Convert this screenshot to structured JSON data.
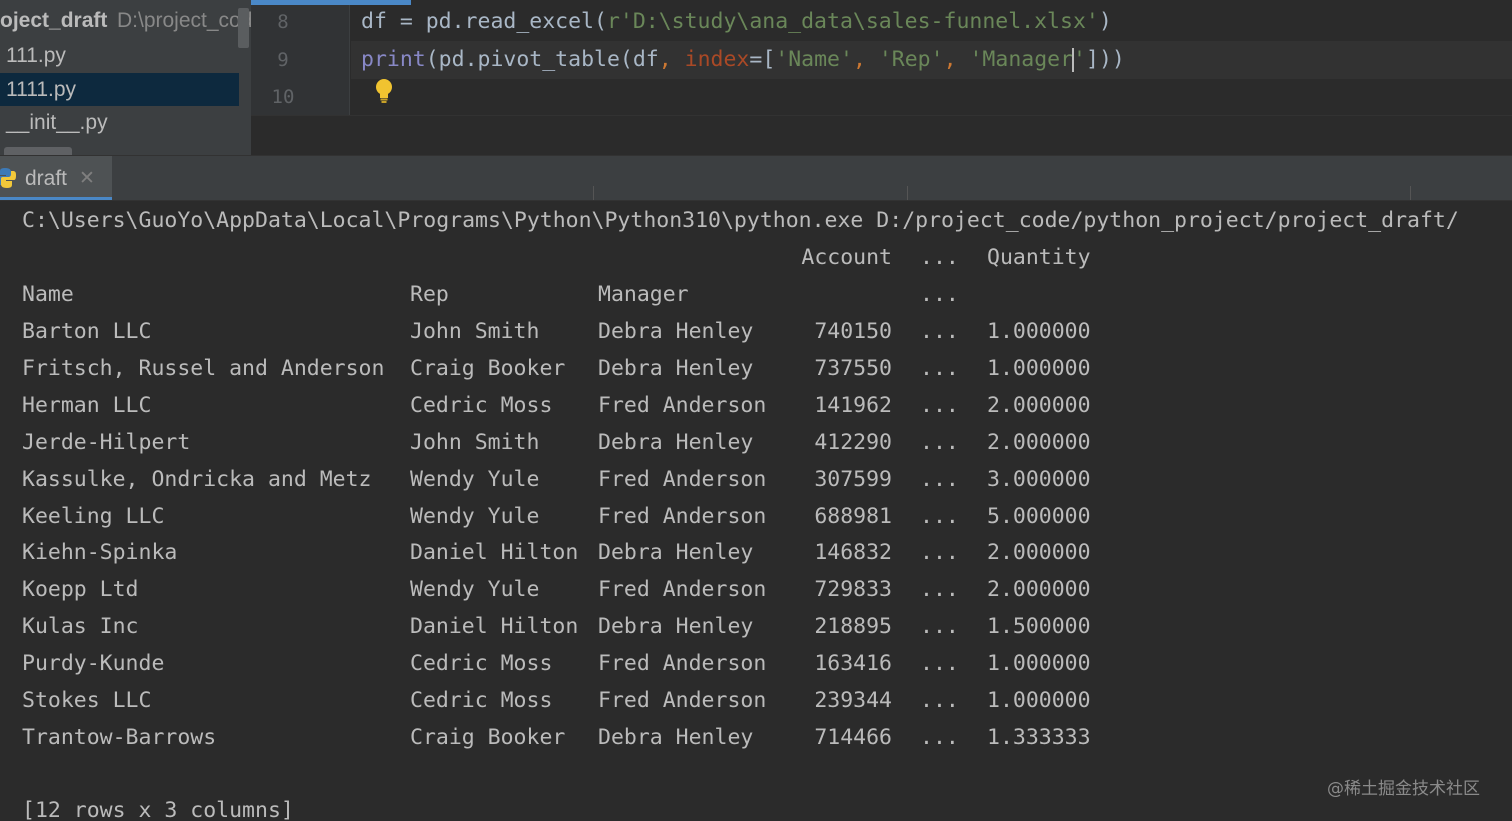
{
  "project_tree": {
    "root_name": "oject_draft",
    "root_path": "D:\\project_cod",
    "items": [
      {
        "label": "111.py",
        "selected": false
      },
      {
        "label": "1111.py",
        "selected": true
      },
      {
        "label": "__init__.py",
        "selected": false
      }
    ]
  },
  "editor": {
    "lines": [
      {
        "number": "8",
        "code": "df = pd.read_excel(r'D:\\study\\ana_data\\sales-funnel.xlsx')"
      },
      {
        "number": "9",
        "code": "print(pd.pivot_table(df, index=['Name', 'Rep', 'Manager']))"
      },
      {
        "number": "10",
        "code": ""
      }
    ],
    "bulb_icon": "lightbulb-icon"
  },
  "run_tab": {
    "label": "draft",
    "close_icon": "close-icon",
    "icon": "python-icon"
  },
  "console": {
    "command": "C:\\Users\\GuoYo\\AppData\\Local\\Programs\\Python\\Python310\\python.exe D:/project_code/python_project/project_draft/",
    "header1": {
      "account": "Account",
      "dots": "...",
      "quantity": "Quantity"
    },
    "header2": {
      "name": "Name",
      "rep": "Rep",
      "manager": "Manager",
      "dots": "..."
    },
    "rows": [
      {
        "name": "Barton LLC",
        "rep": "John Smith",
        "manager": "Debra Henley",
        "account": "740150",
        "dots": "...",
        "quantity": "1.000000"
      },
      {
        "name": "Fritsch, Russel and Anderson",
        "rep": "Craig Booker",
        "manager": "Debra Henley",
        "account": "737550",
        "dots": "...",
        "quantity": "1.000000"
      },
      {
        "name": "Herman LLC",
        "rep": "Cedric Moss",
        "manager": "Fred Anderson",
        "account": "141962",
        "dots": "...",
        "quantity": "2.000000"
      },
      {
        "name": "Jerde-Hilpert",
        "rep": "John Smith",
        "manager": "Debra Henley",
        "account": "412290",
        "dots": "...",
        "quantity": "2.000000"
      },
      {
        "name": "Kassulke, Ondricka and Metz",
        "rep": "Wendy Yule",
        "manager": "Fred Anderson",
        "account": "307599",
        "dots": "...",
        "quantity": "3.000000"
      },
      {
        "name": "Keeling LLC",
        "rep": "Wendy Yule",
        "manager": "Fred Anderson",
        "account": "688981",
        "dots": "...",
        "quantity": "5.000000"
      },
      {
        "name": "Kiehn-Spinka",
        "rep": "Daniel Hilton",
        "manager": "Debra Henley",
        "account": "146832",
        "dots": "...",
        "quantity": "2.000000"
      },
      {
        "name": "Koepp Ltd",
        "rep": "Wendy Yule",
        "manager": "Fred Anderson",
        "account": "729833",
        "dots": "...",
        "quantity": "2.000000"
      },
      {
        "name": "Kulas Inc",
        "rep": "Daniel Hilton",
        "manager": "Debra Henley",
        "account": "218895",
        "dots": "...",
        "quantity": "1.500000"
      },
      {
        "name": "Purdy-Kunde",
        "rep": "Cedric Moss",
        "manager": "Fred Anderson",
        "account": "163416",
        "dots": "...",
        "quantity": "1.000000"
      },
      {
        "name": "Stokes LLC",
        "rep": "Cedric Moss",
        "manager": "Fred Anderson",
        "account": "239344",
        "dots": "...",
        "quantity": "1.000000"
      },
      {
        "name": "Trantow-Barrows",
        "rep": "Craig Booker",
        "manager": "Debra Henley",
        "account": "714466",
        "dots": "...",
        "quantity": "1.333333"
      }
    ],
    "summary": "[12 rows x 3 columns]"
  },
  "watermark": "@稀土掘金技术社区"
}
